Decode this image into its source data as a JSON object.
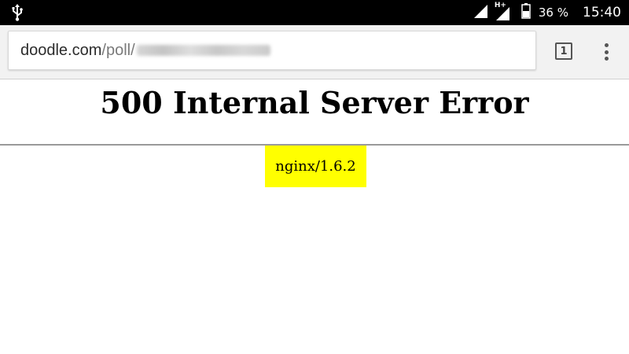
{
  "status_bar": {
    "usb_icon": "usb-icon",
    "network_label": "H+",
    "battery_percent": "36 %",
    "time": "15:40"
  },
  "browser": {
    "url_domain": "doodle.com",
    "url_path": "/poll/",
    "tab_count": "1",
    "menu_icon": "more-vertical-icon"
  },
  "page": {
    "title": "500 Internal Server Error",
    "server_info": "nginx/1.6.2",
    "highlight_color": "#ffff00"
  }
}
